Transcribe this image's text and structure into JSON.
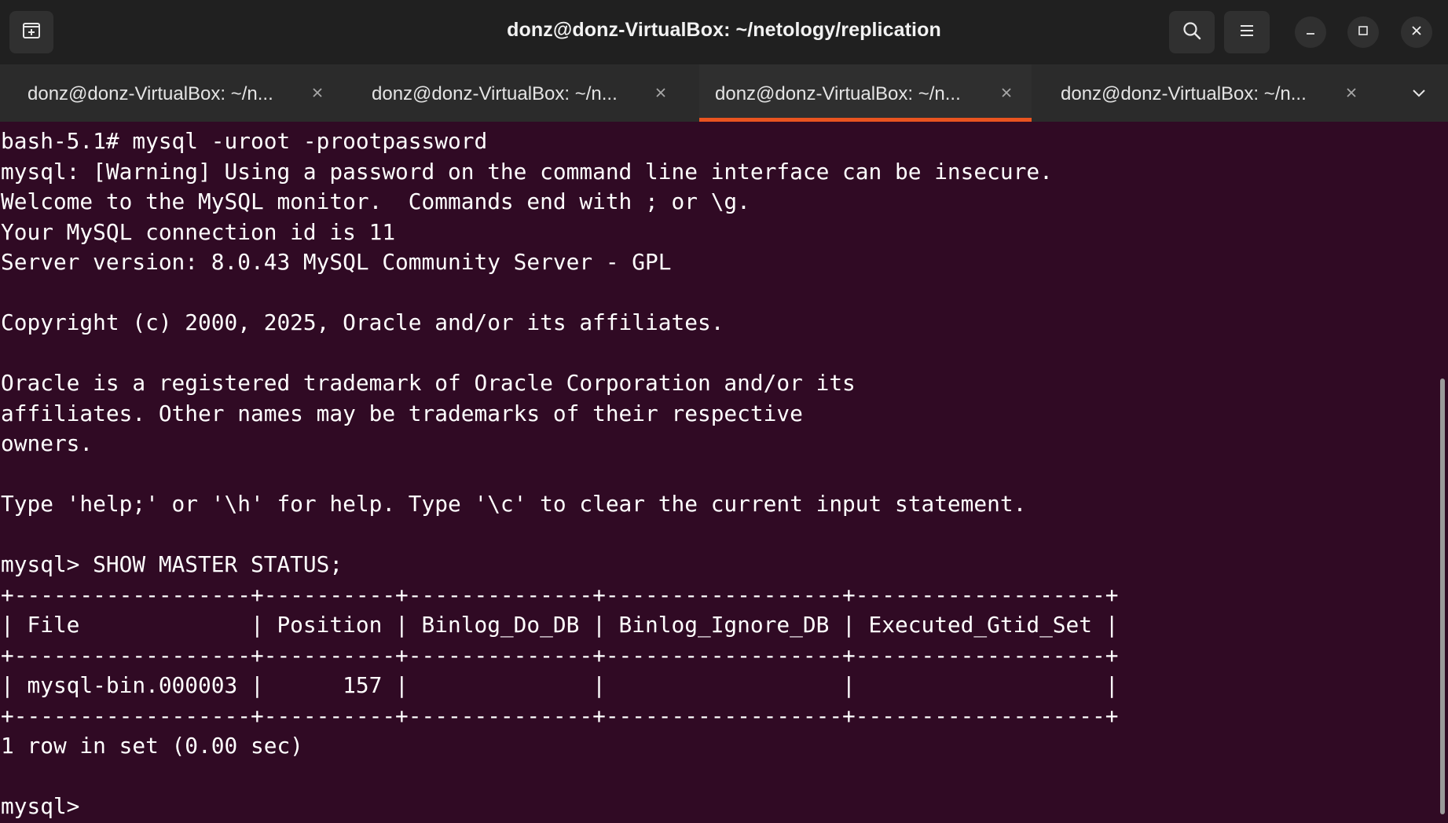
{
  "window": {
    "title": "donz@donz-VirtualBox: ~/netology/replication"
  },
  "header": {
    "icons": {
      "new_tab": "new-tab-icon",
      "search": "search-icon",
      "menu": "hamburger-menu-icon",
      "minimize": "minimize-icon",
      "maximize": "maximize-icon",
      "close": "close-icon"
    }
  },
  "tabs": [
    {
      "label": "donz@donz-VirtualBox: ~/n...",
      "active": false
    },
    {
      "label": "donz@donz-VirtualBox: ~/n...",
      "active": false
    },
    {
      "label": "donz@donz-VirtualBox: ~/n...",
      "active": true
    },
    {
      "label": "donz@donz-VirtualBox: ~/n...",
      "active": false
    }
  ],
  "colors": {
    "terminal_bg": "#300a24",
    "headerbar_bg": "#202020",
    "tabbar_bg": "#2b2b2b",
    "accent": "#e95420",
    "text": "#ffffff"
  },
  "terminal": {
    "lines": [
      "bash-5.1# mysql -uroot -prootpassword",
      "mysql: [Warning] Using a password on the command line interface can be insecure.",
      "Welcome to the MySQL monitor.  Commands end with ; or \\g.",
      "Your MySQL connection id is 11",
      "Server version: 8.0.43 MySQL Community Server - GPL",
      "",
      "Copyright (c) 2000, 2025, Oracle and/or its affiliates.",
      "",
      "Oracle is a registered trademark of Oracle Corporation and/or its",
      "affiliates. Other names may be trademarks of their respective",
      "owners.",
      "",
      "Type 'help;' or '\\h' for help. Type '\\c' to clear the current input statement.",
      "",
      "mysql> SHOW MASTER STATUS;",
      "+------------------+----------+--------------+------------------+-------------------+",
      "| File             | Position | Binlog_Do_DB | Binlog_Ignore_DB | Executed_Gtid_Set |",
      "+------------------+----------+--------------+------------------+-------------------+",
      "| mysql-bin.000003 |      157 |              |                  |                   |",
      "+------------------+----------+--------------+------------------+-------------------+",
      "1 row in set (0.00 sec)",
      "",
      "mysql> "
    ]
  }
}
